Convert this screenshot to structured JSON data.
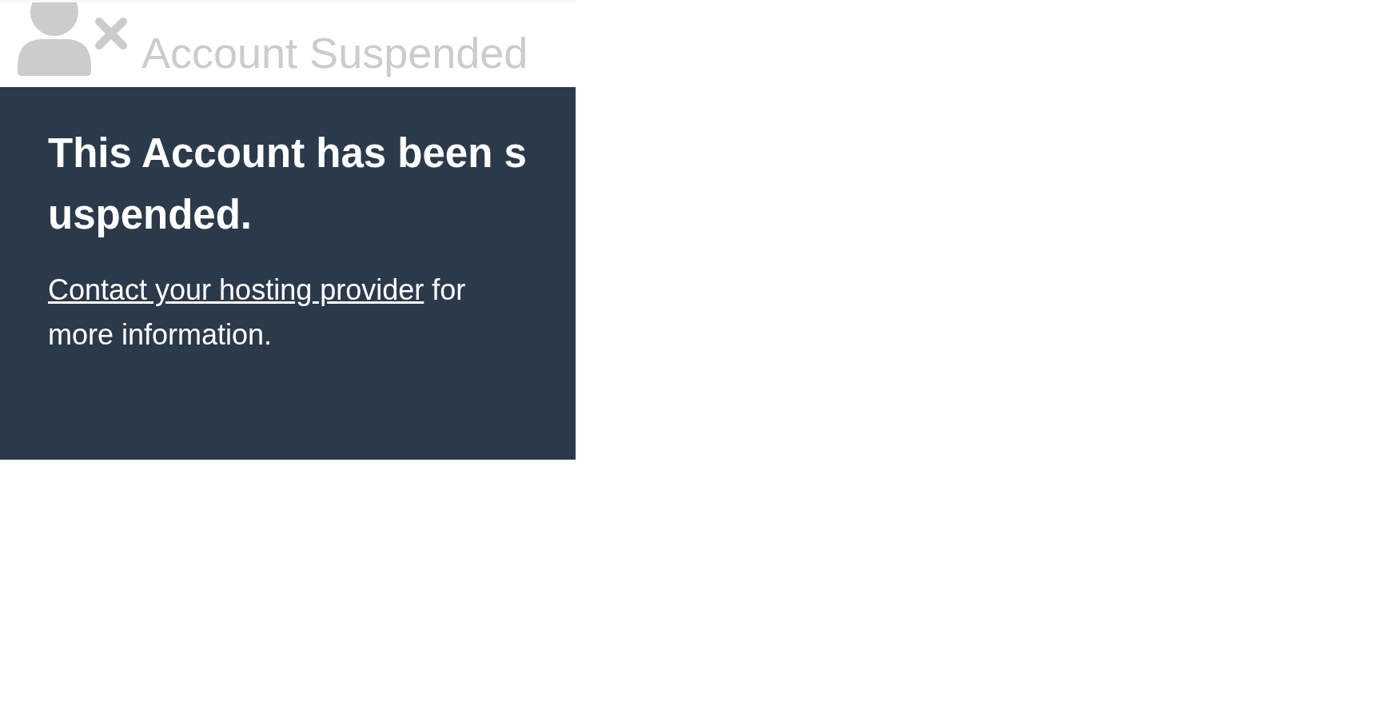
{
  "header": {
    "title": "Account Suspended"
  },
  "message": {
    "heading": "This Account has been suspended.",
    "link": "Contact your hosting provider",
    "text": " for more information."
  }
}
